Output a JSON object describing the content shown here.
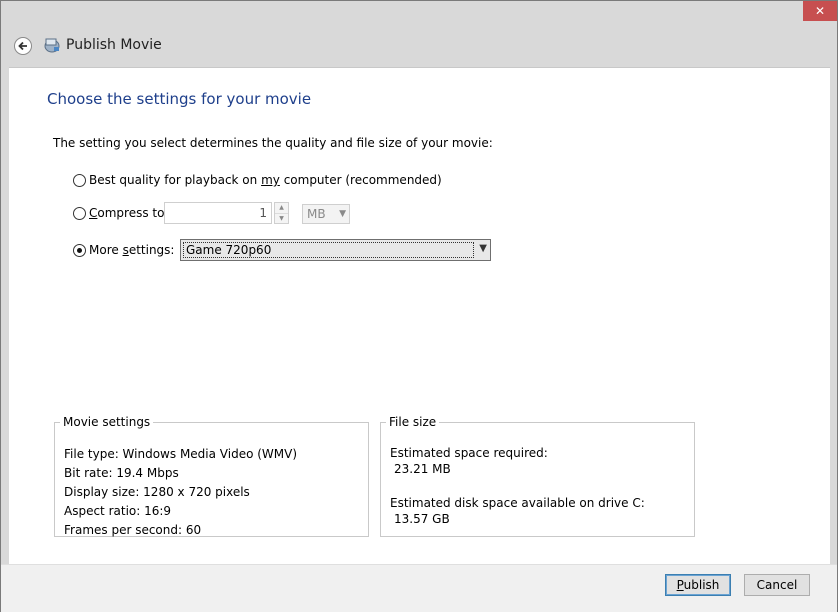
{
  "window": {
    "title": "Publish Movie",
    "close_label": "✕"
  },
  "main": {
    "heading": "Choose the settings for your movie",
    "intro": "The setting you select determines the quality and file size of your movie:"
  },
  "options": {
    "best_quality": {
      "label_before": "Best quality for playback on ",
      "label_underlined": "my",
      "label_after": " computer (recommended)",
      "selected": false
    },
    "compress": {
      "label_underlined": "C",
      "label_after": "ompress to:",
      "value": "1",
      "unit": "MB",
      "selected": false
    },
    "more_settings": {
      "label_before": "More ",
      "label_underlined": "s",
      "label_after": "ettings:",
      "selected_preset": "Game 720p60",
      "selected": true
    }
  },
  "movie_settings": {
    "title": "Movie settings",
    "lines": [
      "File type: Windows Media Video (WMV)",
      "Bit rate: 19.4 Mbps",
      "Display size: 1280 x 720 pixels",
      "Aspect ratio: 16:9",
      "Frames per second: 60"
    ]
  },
  "file_size": {
    "title": "File size",
    "required_label": "Estimated space required:",
    "required_value": "23.21 MB",
    "available_label": "Estimated disk space available on drive C:",
    "available_value": "13.57 GB"
  },
  "footer": {
    "publish_underlined": "P",
    "publish_rest": "ublish",
    "cancel_label": "Cancel"
  },
  "icons": {
    "back": "back-arrow-icon",
    "app": "publish-movie-icon"
  },
  "colors": {
    "heading": "#1e3f8b",
    "close_button": "#c74f50",
    "chrome": "#d9d9d9"
  }
}
